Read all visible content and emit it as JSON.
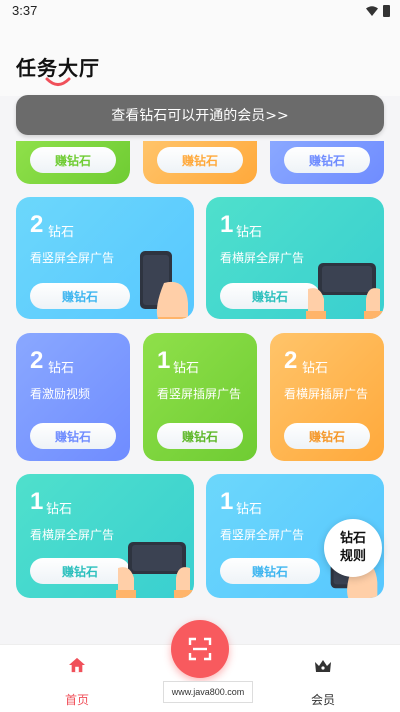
{
  "status_bar": {
    "time": "3:37"
  },
  "header": {
    "title": "任务大厅"
  },
  "banner": {
    "text": "查看钻石可以开通的会员>>"
  },
  "earn_label": "赚钻石",
  "unit_label": "钻石",
  "cards": [
    {
      "amount": "2",
      "desc": "看竖屏全屏广告",
      "color": "#5fcffd"
    },
    {
      "amount": "1",
      "desc": "看横屏全屏广告",
      "color": "#43d8cf"
    },
    {
      "amount": "2",
      "desc": "看激励视频",
      "color": "#7d9bff"
    },
    {
      "amount": "1",
      "desc": "看竖屏插屏广告",
      "color": "#7ed53e"
    },
    {
      "amount": "2",
      "desc": "看横屏插屏广告",
      "color": "#ffb84f"
    },
    {
      "amount": "1",
      "desc": "看横屏全屏广告",
      "color": "#43d8cf"
    },
    {
      "amount": "1",
      "desc": "看竖屏全屏广告",
      "color": "#5fcffd"
    }
  ],
  "rules_bubble": {
    "line1": "钻石",
    "line2": "规则"
  },
  "tabs": {
    "home": "首页",
    "member": "会员"
  },
  "watermark": "www.java800.com",
  "colors": {
    "accent": "#f85a5e",
    "banner": "#6b6b6b"
  },
  "icons": [
    "wifi-icon",
    "battery-icon",
    "home-icon",
    "scan-icon",
    "crown-icon",
    "phone-portrait-icon",
    "phone-landscape-icon"
  ]
}
